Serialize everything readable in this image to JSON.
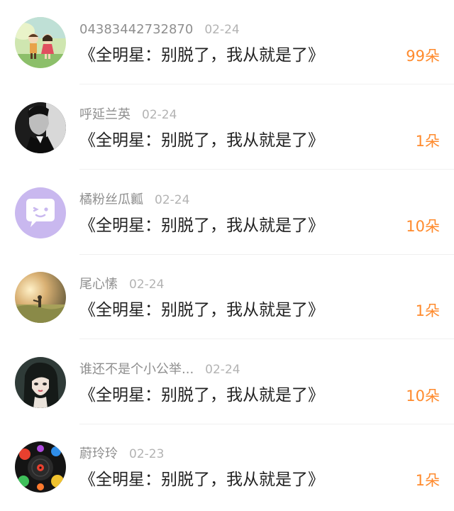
{
  "items": [
    {
      "username": "04383442732870",
      "date": "02-24",
      "title": "《全明星：别脱了，我从就是了》",
      "count": "99朵",
      "avatar_icon": "cartoon-couple-avatar-icon"
    },
    {
      "username": "呼延兰英",
      "date": "02-24",
      "title": "《全明星：别脱了，我从就是了》",
      "count": "1朵",
      "avatar_icon": "man-portrait-avatar-icon"
    },
    {
      "username": "橘粉丝瓜瓤",
      "date": "02-24",
      "title": "《全明星：别脱了，我从就是了》",
      "count": "10朵",
      "avatar_icon": "chat-bubble-face-avatar-icon"
    },
    {
      "username": "尾心愫",
      "date": "02-24",
      "title": "《全明星：别脱了，我从就是了》",
      "count": "1朵",
      "avatar_icon": "sunset-field-avatar-icon"
    },
    {
      "username": "谁还不是个小公举...",
      "date": "02-24",
      "title": "《全明星：别脱了，我从就是了》",
      "count": "10朵",
      "avatar_icon": "anime-girl-avatar-icon"
    },
    {
      "username": "蔚玲玲",
      "date": "02-23",
      "title": "《全明星：别脱了，我从就是了》",
      "count": "1朵",
      "avatar_icon": "colorful-vinyl-avatar-icon"
    }
  ],
  "colors": {
    "accent": "#ff8a2c",
    "username": "#8f8f8f",
    "date": "#b3b3b3",
    "title": "#222222"
  }
}
